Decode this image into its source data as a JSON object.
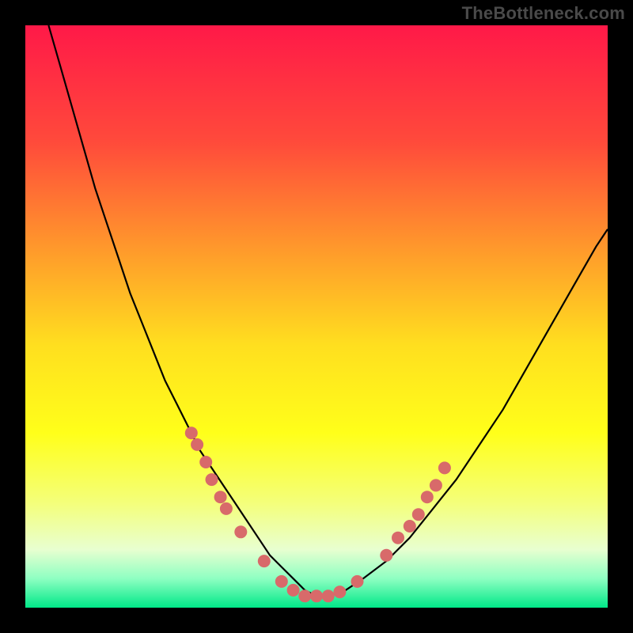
{
  "watermark": "TheBottleneck.com",
  "chart_data": {
    "type": "line",
    "title": "",
    "xlabel": "",
    "ylabel": "",
    "xlim": [
      0,
      100
    ],
    "ylim": [
      0,
      100
    ],
    "legend": false,
    "grid": false,
    "background": {
      "type": "vertical-gradient",
      "stops": [
        {
          "pos": 0.0,
          "color": "#ff1948"
        },
        {
          "pos": 0.2,
          "color": "#ff4a3b"
        },
        {
          "pos": 0.4,
          "color": "#ffa02a"
        },
        {
          "pos": 0.55,
          "color": "#ffdf1f"
        },
        {
          "pos": 0.7,
          "color": "#ffff1a"
        },
        {
          "pos": 0.82,
          "color": "#f4ff7a"
        },
        {
          "pos": 0.9,
          "color": "#e8ffd0"
        },
        {
          "pos": 0.95,
          "color": "#8effc2"
        },
        {
          "pos": 1.0,
          "color": "#00e888"
        }
      ]
    },
    "series": [
      {
        "name": "bottleneck-curve",
        "color": "#000000",
        "x": [
          4,
          6,
          8,
          10,
          12,
          14,
          16,
          18,
          20,
          22,
          24,
          26,
          28,
          30,
          32,
          34,
          36,
          38,
          40,
          42,
          44,
          46,
          48,
          50,
          52,
          55,
          58,
          62,
          66,
          70,
          74,
          78,
          82,
          86,
          90,
          94,
          98,
          100
        ],
        "y": [
          100,
          93,
          86,
          79,
          72,
          66,
          60,
          54,
          49,
          44,
          39,
          35,
          31,
          27,
          24,
          21,
          18,
          15,
          12,
          9,
          7,
          5,
          3,
          2,
          2,
          3,
          5,
          8,
          12,
          17,
          22,
          28,
          34,
          41,
          48,
          55,
          62,
          65
        ]
      }
    ],
    "scatter": {
      "name": "curve-markers",
      "color": "#d86a6a",
      "radius": 8,
      "points": [
        {
          "x": 28.5,
          "y": 30
        },
        {
          "x": 29.5,
          "y": 28
        },
        {
          "x": 31,
          "y": 25
        },
        {
          "x": 32,
          "y": 22
        },
        {
          "x": 33.5,
          "y": 19
        },
        {
          "x": 34.5,
          "y": 17
        },
        {
          "x": 37,
          "y": 13
        },
        {
          "x": 41,
          "y": 8
        },
        {
          "x": 44,
          "y": 4.5
        },
        {
          "x": 46,
          "y": 3
        },
        {
          "x": 48,
          "y": 2
        },
        {
          "x": 50,
          "y": 2
        },
        {
          "x": 52,
          "y": 2
        },
        {
          "x": 54,
          "y": 2.7
        },
        {
          "x": 57,
          "y": 4.5
        },
        {
          "x": 62,
          "y": 9
        },
        {
          "x": 64,
          "y": 12
        },
        {
          "x": 66,
          "y": 14
        },
        {
          "x": 67.5,
          "y": 16
        },
        {
          "x": 69,
          "y": 19
        },
        {
          "x": 70.5,
          "y": 21
        },
        {
          "x": 72,
          "y": 24
        }
      ]
    }
  }
}
